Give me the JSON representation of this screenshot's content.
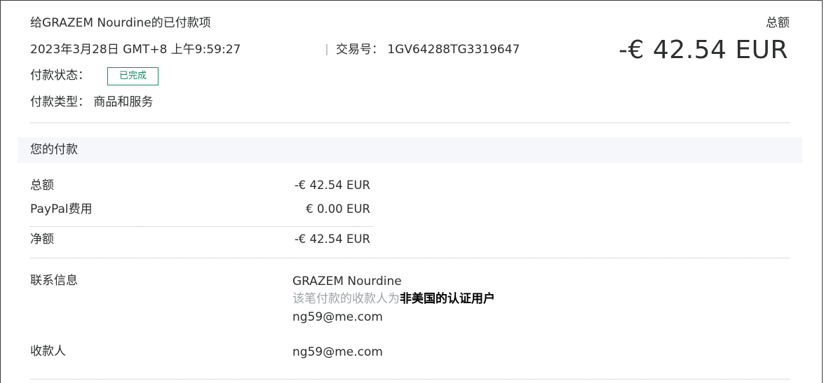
{
  "header": {
    "title": "给GRAZEM Nourdine的已付款项",
    "datetime": "2023年3月28日 GMT+8 上午9:59:27",
    "transaction_label": "交易号：",
    "transaction_id": "1GV64288TG3319647",
    "total_label": "总额",
    "total_amount": "-€ 42.54 EUR",
    "status_label": "付款状态：",
    "status_badge": "已完成",
    "type_label": "付款类型：",
    "type_value": "商品和服务"
  },
  "payment": {
    "section_title": "您的付款",
    "rows": [
      {
        "label": "总额",
        "value": "-€ 42.54 EUR"
      },
      {
        "label": "PayPal费用",
        "value": "€ 0.00 EUR"
      },
      {
        "label": "净额",
        "value": "-€ 42.54 EUR"
      }
    ]
  },
  "contact": {
    "label": "联系信息",
    "name": "GRAZEM Nourdine",
    "note_prefix": "该笔付款的收款人为",
    "note_bold": "非美国的认证用户",
    "email": "ng59@me.com"
  },
  "recipient": {
    "label": "收款人",
    "email": "ng59@me.com"
  },
  "colors": {
    "badge": "#1a8a6a",
    "band": "#f5f7fa",
    "text": "#2c2e2f",
    "muted": "#9da3a6"
  }
}
